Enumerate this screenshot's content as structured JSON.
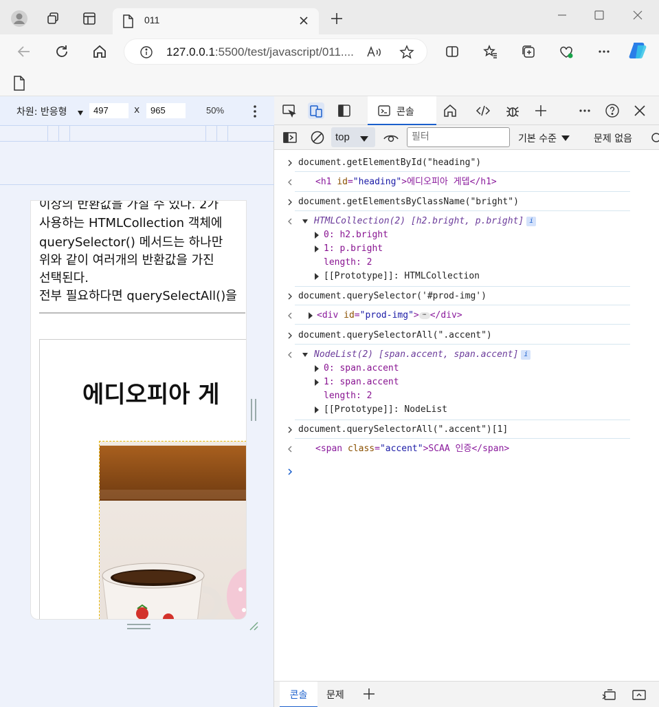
{
  "browser": {
    "tab_title": "011",
    "url_host": "127.0.0.1",
    "url_rest": ":5500/test/javascript/011...."
  },
  "device_toolbar": {
    "dimensions_label": "차원: 반응형",
    "width_value": "497",
    "times": "x",
    "height_value": "965",
    "zoom": "50%"
  },
  "viewport": {
    "lines": [
      "이상의 반환값을 가질 수 있다. 2가",
      "사용하는 HTMLCollection 객체에",
      "querySelector() 메서드는 하나만 ",
      "위와 같이 여러개의 반환값을 가진",
      "선택된다.",
      "전부 필요하다면 querySelectAll()을"
    ],
    "heading": "에디오피아 게"
  },
  "devtools": {
    "tabs": {
      "console": "콘솔"
    },
    "toolbar": {
      "context": "top",
      "filter_placeholder": "필터",
      "level": "기본 수준",
      "issues": "문제 없음"
    },
    "drawer": {
      "console": "콘솔",
      "issues": "문제"
    }
  },
  "console": {
    "cmd1": "document.getElementById(\"heading\")",
    "r1_tag_open": "<h1 ",
    "r1_attr": "id",
    "r1_val": "\"heading\"",
    "r1_text": ">에디오피아 게뎁</h1>",
    "cmd2": "document.getElementsByClassName(\"bright\")",
    "r2_head": "HTMLCollection(2) [h2.bright, p.bright]",
    "r2_items": [
      "0: h2.bright",
      "1: p.bright"
    ],
    "r2_length": "length: 2",
    "r2_proto": "[[Prototype]]: HTMLCollection",
    "cmd3": "document.querySelector('#prod-img')",
    "r3_open": "<div ",
    "r3_attr": "id",
    "r3_val": "\"prod-img\"",
    "r3_close": "</div>",
    "cmd4": "document.querySelectorAll(\".accent\")",
    "r4_head": "NodeList(2) [span.accent, span.accent]",
    "r4_items": [
      "0: span.accent",
      "1: span.accent"
    ],
    "r4_length": "length: 2",
    "r4_proto": "[[Prototype]]: NodeList",
    "cmd5": "document.querySelectorAll(\".accent\")[1]",
    "r5_open": "<span ",
    "r5_attr": "class",
    "r5_val": "\"accent\"",
    "r5_text": ">SCAA 인증</span>"
  }
}
